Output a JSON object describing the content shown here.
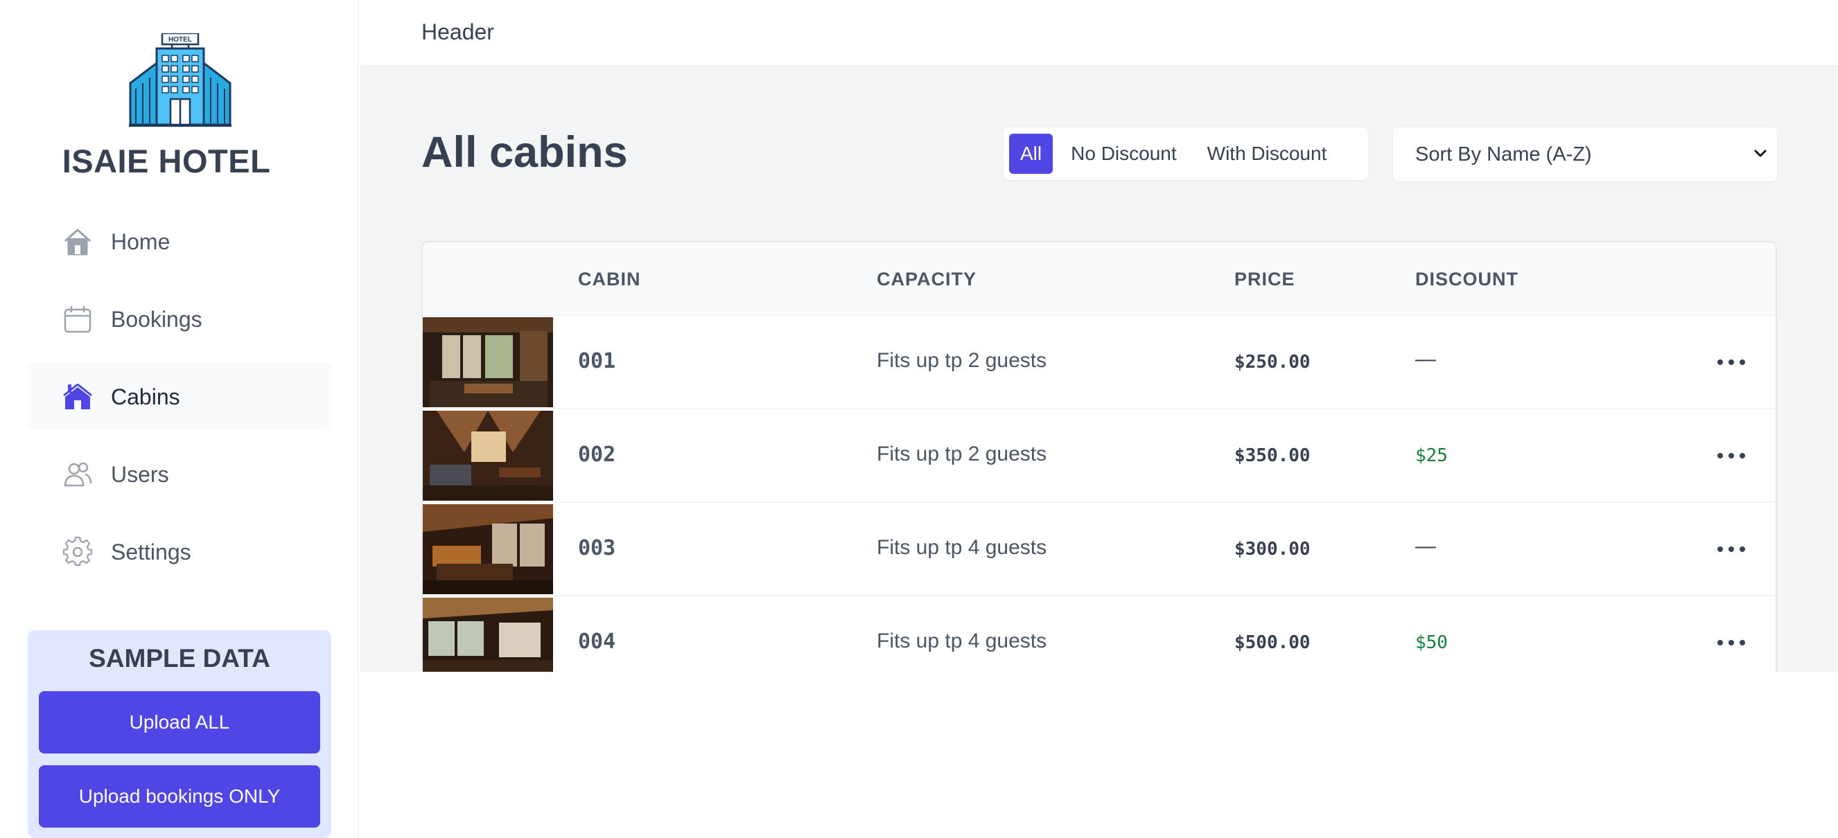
{
  "brand": {
    "name": "ISAIE HOTEL",
    "logo_sign": "HOTEL"
  },
  "sidebar": {
    "items": [
      {
        "label": "Home",
        "icon": "home-icon",
        "active": false
      },
      {
        "label": "Bookings",
        "icon": "calendar-icon",
        "active": false
      },
      {
        "label": "Cabins",
        "icon": "cabin-icon",
        "active": true
      },
      {
        "label": "Users",
        "icon": "users-icon",
        "active": false
      },
      {
        "label": "Settings",
        "icon": "gear-icon",
        "active": false
      }
    ],
    "sample": {
      "title": "SAMPLE DATA",
      "upload_all": "Upload ALL",
      "upload_bookings": "Upload bookings ONLY"
    }
  },
  "header": {
    "title": "Header"
  },
  "main": {
    "title": "All cabins",
    "filters": [
      {
        "label": "All",
        "active": true
      },
      {
        "label": "No Discount",
        "active": false
      },
      {
        "label": "With Discount",
        "active": false
      }
    ],
    "sort": {
      "selected": "Sort By Name (A-Z)"
    },
    "table": {
      "columns": [
        "CABIN",
        "CAPACITY",
        "PRICE",
        "DISCOUNT"
      ],
      "rows": [
        {
          "name": "001",
          "capacity": "Fits up tp 2 guests",
          "price": "$250.00",
          "discount": "—"
        },
        {
          "name": "002",
          "capacity": "Fits up tp 2 guests",
          "price": "$350.00",
          "discount": "$25"
        },
        {
          "name": "003",
          "capacity": "Fits up tp 4 guests",
          "price": "$300.00",
          "discount": "—"
        },
        {
          "name": "004",
          "capacity": "Fits up tp 4 guests",
          "price": "$500.00",
          "discount": "$50"
        }
      ]
    }
  },
  "colors": {
    "accent": "#4f46e5",
    "accent_light": "#e0e7ff",
    "discount_green": "#15803d",
    "logo_blue": "#29abe2"
  }
}
